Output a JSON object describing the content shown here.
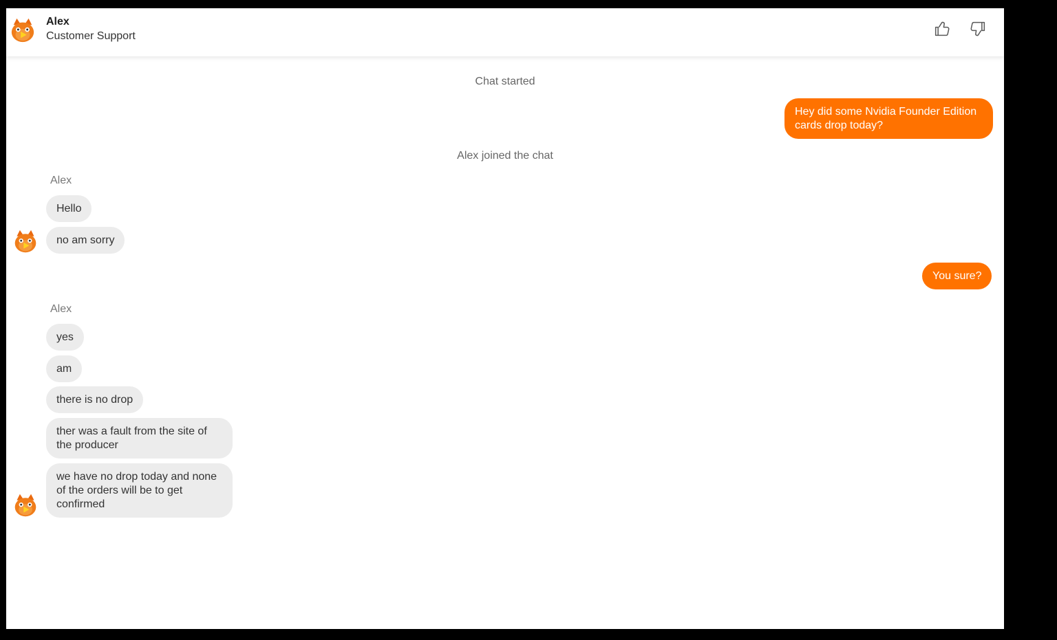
{
  "colors": {
    "accent": "#ff7200",
    "incoming_bubble": "#ececec",
    "background": "#ffffff"
  },
  "header": {
    "agent_name": "Alex",
    "agent_role": "Customer Support",
    "avatar_icon": "fox-mascot-icon",
    "thumbs_up_icon": "thumbs-up-icon",
    "thumbs_down_icon": "thumbs-down-icon"
  },
  "conversation": {
    "chat_started": "Chat started",
    "user_message_1": "Hey did some Nvidia Founder Edition cards drop today?",
    "agent_joined": "Alex joined the chat",
    "group1_sender": "Alex",
    "group1_messages": [
      "Hello",
      "no am sorry"
    ],
    "user_message_2": "You sure?",
    "group2_sender": "Alex",
    "group2_messages": [
      "yes",
      "am",
      "there is no drop",
      "ther was a fault from the site of the producer",
      "we have no drop today and none of the orders will be to get confirmed"
    ]
  }
}
